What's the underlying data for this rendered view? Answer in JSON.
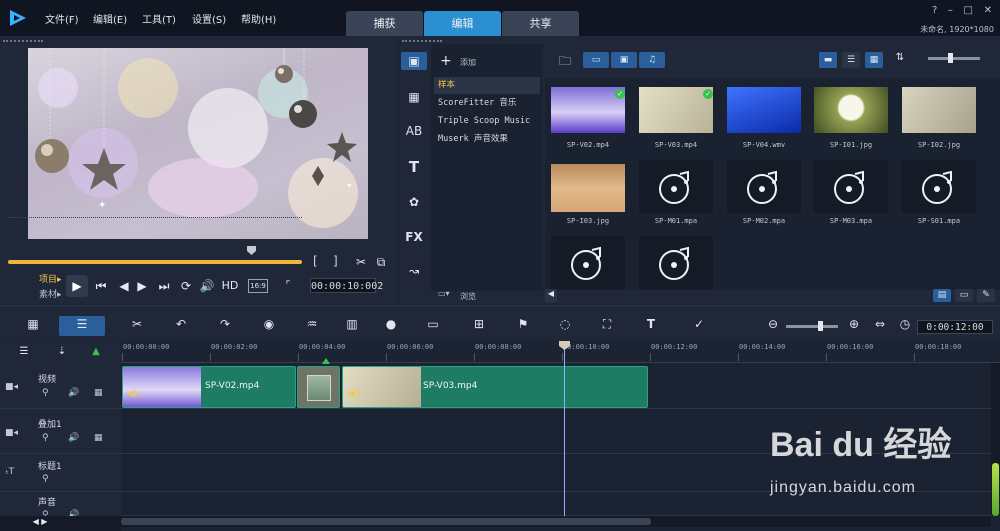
{
  "menubar": {
    "items": [
      "文件(F)",
      "编辑(E)",
      "工具(T)",
      "设置(S)",
      "帮助(H)"
    ],
    "tabs": [
      "捕获",
      "编辑",
      "共享"
    ],
    "active_tab": "编辑",
    "window_controls": [
      "?",
      "–",
      "□",
      "✕"
    ],
    "project_info": "未命名, 1920*1080"
  },
  "preview": {
    "mode_project": "项目▸",
    "mode_clip": "素材▸",
    "mark_in": "[",
    "mark_out": "]",
    "quality": "HD",
    "aspect": "16:9",
    "timecode": "00:00:10:002"
  },
  "library": {
    "add_label": "添加",
    "browse_label": "浏览",
    "folders": [
      {
        "label": "样本",
        "selected": true
      },
      {
        "label": "ScoreFitter 音乐",
        "selected": false
      },
      {
        "label": "Triple Scoop Music",
        "selected": false
      },
      {
        "label": "Muserk 声音效果",
        "selected": false
      }
    ],
    "items": [
      {
        "name": "SP-V02.mp4",
        "kind": "video-purple",
        "checked": true
      },
      {
        "name": "SP-V03.mp4",
        "kind": "video-beige",
        "checked": true
      },
      {
        "name": "SP-V04.wmv",
        "kind": "video-blue",
        "checked": false
      },
      {
        "name": "SP-I01.jpg",
        "kind": "image-dandelion",
        "checked": false
      },
      {
        "name": "SP-I02.jpg",
        "kind": "image-beige",
        "checked": false
      },
      {
        "name": "SP-I03.jpg",
        "kind": "image-desert",
        "checked": false
      },
      {
        "name": "SP-M01.mpa",
        "kind": "audio",
        "checked": false
      },
      {
        "name": "SP-M02.mpa",
        "kind": "audio",
        "checked": false
      },
      {
        "name": "SP-M03.mpa",
        "kind": "audio",
        "checked": false
      },
      {
        "name": "SP-S01.mpa",
        "kind": "audio",
        "checked": false
      },
      {
        "name": "",
        "kind": "audio",
        "checked": false
      },
      {
        "name": "",
        "kind": "audio",
        "checked": false
      }
    ]
  },
  "timeline": {
    "timecode": "0:00:12:00",
    "ruler": [
      "00:00:00:00",
      "00:00:02:00",
      "00:00:04:00",
      "00:00:06:00",
      "00:00:08:00",
      "00:00:10:00",
      "00:00:12:00",
      "00:00:14:00",
      "00:00:16:00",
      "00:00:18:00"
    ],
    "tracks": [
      {
        "name": "视频"
      },
      {
        "name": "叠加1"
      },
      {
        "name": "标题1"
      },
      {
        "name": "声音"
      }
    ],
    "clips": [
      {
        "label": "SP-V02.mp4"
      },
      {
        "label": "SP-V03.mp4"
      }
    ]
  },
  "watermark": {
    "brand": "Bai du 经验",
    "url": "jingyan.baidu.com"
  },
  "colors": {
    "accent": "#2b8fd2",
    "clip": "#1d7c63",
    "scrub": "#f0b53a"
  }
}
